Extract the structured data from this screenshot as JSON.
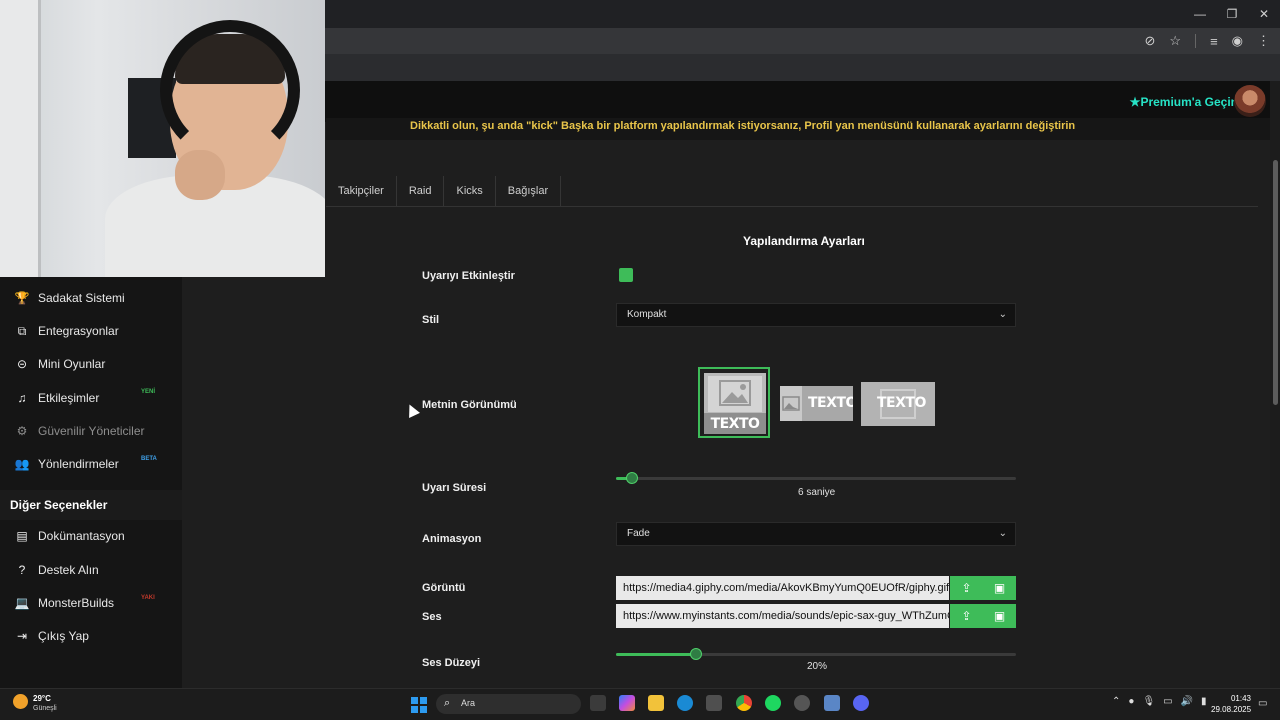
{
  "browser": {
    "window_controls": {
      "minimize": "—",
      "maximize": "❐",
      "close": "✕"
    },
    "url_icons": [
      "eye-slash-icon",
      "star-icon",
      "media-icon",
      "avatar-icon",
      "menu-icon"
    ]
  },
  "header": {
    "premium_label": "Premium'a Geçin",
    "warning": "Dikkatli olun, şu anda \"kick\" Başka bir platform yapılandırmak istiyorsanız, Profil yan menüsünü kullanarak ayarlarını değiştirin"
  },
  "tabs": [
    "Takipçiler",
    "Raid",
    "Kicks",
    "Bağışlar"
  ],
  "sidebar": {
    "items": [
      {
        "label": "Sadakat Sistemi",
        "icon": "trophy-icon",
        "glyph": "🏆"
      },
      {
        "label": "Entegrasyonlar",
        "icon": "plugin-icon",
        "glyph": "⧉"
      },
      {
        "label": "Mini Oyunlar",
        "icon": "gamepad-icon",
        "glyph": "⊝"
      },
      {
        "label": "Etkileşimler",
        "icon": "music-icon",
        "glyph": "♫",
        "badge": "YENİ",
        "badge_color": "#3ebc59"
      },
      {
        "label": "Güvenilir Yöneticiler",
        "icon": "users-icon",
        "glyph": "⚙"
      },
      {
        "label": "Yönlendirmeler",
        "icon": "people-icon",
        "glyph": "👥",
        "badge": "BETA",
        "badge_color": "#3fa0e8"
      }
    ],
    "section_title": "Diğer Seçenekler",
    "other_items": [
      {
        "label": "Dokümantasyon",
        "icon": "docs-icon",
        "glyph": "▤"
      },
      {
        "label": "Destek Alın",
        "icon": "help-icon",
        "glyph": "?"
      },
      {
        "label": "MonsterBuilds",
        "icon": "laptop-icon",
        "glyph": "💻",
        "badge": "YAKI",
        "badge_color": "#c0392b"
      },
      {
        "label": "Çıkış Yap",
        "icon": "logout-icon",
        "glyph": "⇥"
      }
    ]
  },
  "config": {
    "title": "Yapılandırma Ayarları",
    "enable_label": "Uyarıyı Etkinleştir",
    "enable_checked": true,
    "style_label": "Stil",
    "style_value": "Kompakt",
    "text_view_label": "Metnin Görünümü",
    "text_view_sample": "TEXTO",
    "duration_label": "Uyarı Süresi",
    "duration_value": "6 saniye",
    "duration_fraction": 0.04,
    "animation_label": "Animasyon",
    "animation_value": "Fade",
    "image_label": "Görüntü",
    "image_url": "https://media4.giphy.com/media/AkovKBmyYumQ0EUOfR/giphy.gif?",
    "sound_label": "Ses",
    "sound_url": "https://www.myinstants.com/media/sounds/epic-sax-guy_WThZumG",
    "volume_label": "Ses Düzeyi",
    "volume_value": "20%",
    "volume_fraction": 0.2,
    "upload_glyph": "⇪",
    "gallery_glyph": "▣"
  },
  "taskbar": {
    "weather_temp": "29°C",
    "weather_desc": "Güneşli",
    "search_label": "Ara",
    "search_glyph": "⌕",
    "time": "01:43",
    "date": "29.08.2025"
  },
  "colors": {
    "accent": "#3ebc59",
    "premium": "#27e3c6",
    "warning": "#e9c54a"
  }
}
